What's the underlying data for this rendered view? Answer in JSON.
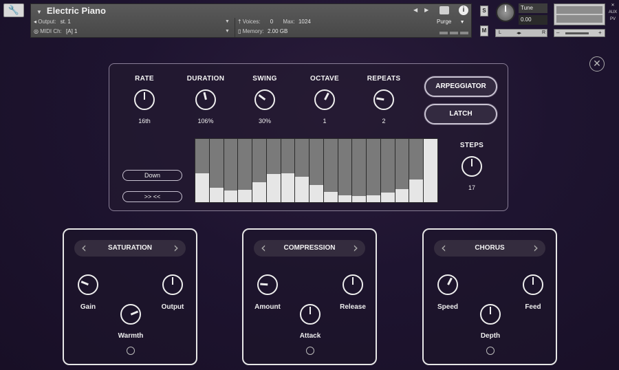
{
  "colors": {
    "panel_border": "#8a7f98",
    "accent": "#e6e6e6",
    "step_bg": "#7a7a7a",
    "step_fill": "#e6e6e6"
  },
  "header": {
    "instrument_name": "Electric Piano",
    "output_label": "Output:",
    "output_value": "st. 1",
    "midi_label": "MIDI Ch:",
    "midi_value": "[A]  1",
    "voices_label": "Voices:",
    "voices_value": "0",
    "max_label": "Max:",
    "max_value": "1024",
    "memory_label": "Memory:",
    "memory_value": "2.00 GB",
    "purge_label": "Purge",
    "s_label": "S",
    "m_label": "M",
    "tune_label": "Tune",
    "tune_value": "0.00",
    "pan_left": "L",
    "pan_center": "◂▸",
    "pan_right": "R",
    "vol_minus": "–",
    "vol_plus": "+",
    "side_labels": [
      "✕",
      "AUX",
      "PV"
    ],
    "icons": [
      "wrench-icon",
      "camera-icon",
      "info-icon",
      "close-icon"
    ]
  },
  "arp": {
    "knobs": [
      {
        "name": "RATE",
        "value": "16th",
        "level": 0.5
      },
      {
        "name": "DURATION",
        "value": "106%",
        "level": 0.45
      },
      {
        "name": "SWING",
        "value": "30%",
        "level": 0.3
      },
      {
        "name": "OCTAVE",
        "value": "1",
        "level": 0.6
      },
      {
        "name": "REPEATS",
        "value": "2",
        "level": 0.2
      }
    ],
    "arpeggiator_label": "ARPEGGIATOR",
    "latch_label": "LATCH",
    "direction_label": "Down",
    "shift_label": ">> <<",
    "steps_label": "STEPS",
    "steps_value": "17",
    "steps_level": 0.5,
    "step_levels": [
      0.46,
      0.23,
      0.18,
      0.2,
      0.32,
      0.45,
      0.46,
      0.4,
      0.27,
      0.16,
      0.11,
      0.1,
      0.11,
      0.15,
      0.21,
      0.36,
      1.0
    ]
  },
  "fx": [
    {
      "title": "SATURATION",
      "knobs": [
        "Gain",
        "Output",
        "Warmth"
      ],
      "levels": [
        0.25,
        0.5,
        0.75
      ]
    },
    {
      "title": "COMPRESSION",
      "knobs": [
        "Amount",
        "Release",
        "Attack"
      ],
      "levels": [
        0.18,
        0.5,
        0.5
      ]
    },
    {
      "title": "CHORUS",
      "knobs": [
        "Speed",
        "Feed",
        "Depth"
      ],
      "levels": [
        0.6,
        0.5,
        0.5
      ]
    }
  ]
}
